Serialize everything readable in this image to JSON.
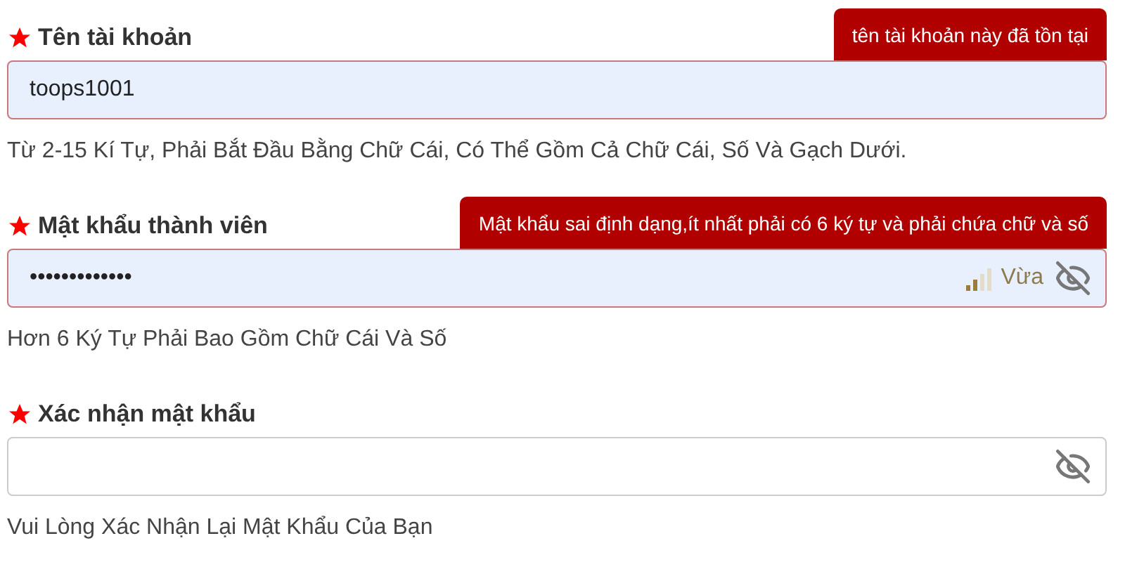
{
  "fields": [
    {
      "label": "Tên tài khoản",
      "required": true,
      "value": "toops1001",
      "invalid": true,
      "error": "tên tài khoản này đã tồn tại",
      "hint": "Từ 2-15 Kí Tự, Phải Bắt Đầu Bằng Chữ Cái, Có Thể Gồm Cả Chữ Cái, Số Và Gạch Dưới."
    },
    {
      "label": "Mật khẩu thành viên",
      "required": true,
      "value": "•••••••••••••",
      "invalid": true,
      "error": "Mật khẩu sai định dạng,ít nhất phải có 6 ký tự và phải chứa chữ và số",
      "strength": {
        "label": "Vừa"
      },
      "visibility_toggle": true,
      "hint": "Hơn 6 Ký Tự Phải Bao Gồm Chữ Cái Và Số"
    },
    {
      "label": "Xác nhận mật khẩu",
      "required": true,
      "invalid": false,
      "visibility_toggle": true,
      "hint": "Vui Lòng Xác Nhận Lại Mật Khẩu Của Bạn"
    }
  ]
}
